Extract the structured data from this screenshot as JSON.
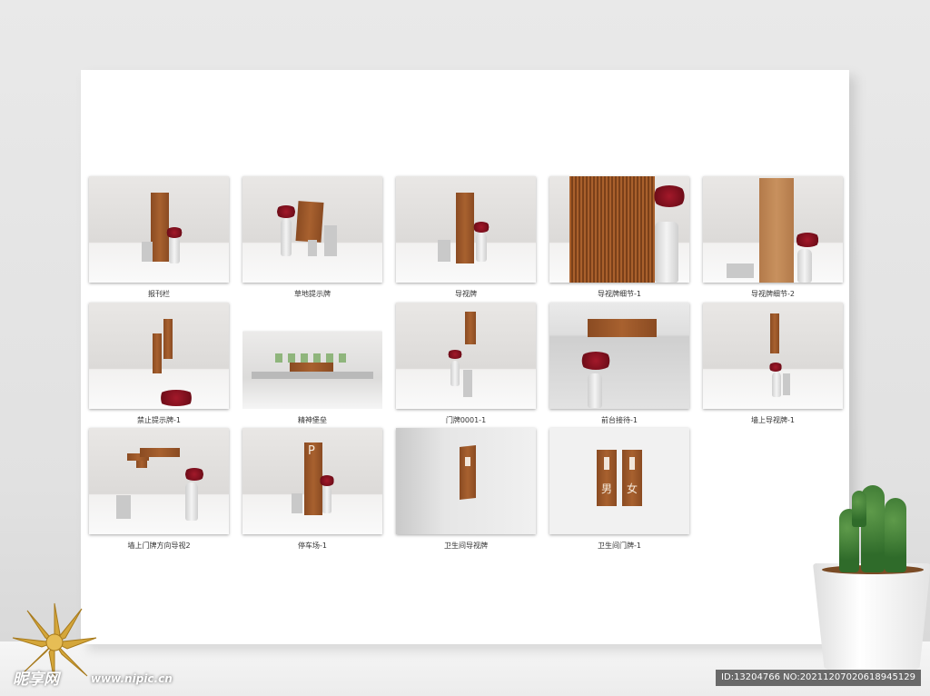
{
  "tiles": [
    {
      "caption": "报刊栏"
    },
    {
      "caption": "草地提示牌"
    },
    {
      "caption": "导视牌"
    },
    {
      "caption": "导视牌细节-1"
    },
    {
      "caption": "导视牌细节-2"
    },
    {
      "caption": "禁止提示牌-1"
    },
    {
      "caption": "精神堡垒"
    },
    {
      "caption": "门牌0001-1"
    },
    {
      "caption": "前台接待-1"
    },
    {
      "caption": "墙上导视牌-1"
    },
    {
      "caption": "墙上门牌方向导视2"
    },
    {
      "caption": "停车场-1"
    },
    {
      "caption": "卫生间导视牌"
    },
    {
      "caption": "卫生间门牌-1"
    }
  ],
  "restroom_sign": {
    "male": "男",
    "female": "女"
  },
  "parking_sign": {
    "letter": "P"
  },
  "watermark": {
    "logo": "昵享网",
    "url": "www.nipic.cn",
    "id_text": "ID:13204766 NO:20211207020618945129"
  },
  "colors": {
    "wood": "#a8612f",
    "accent_red": "#8b1020"
  }
}
